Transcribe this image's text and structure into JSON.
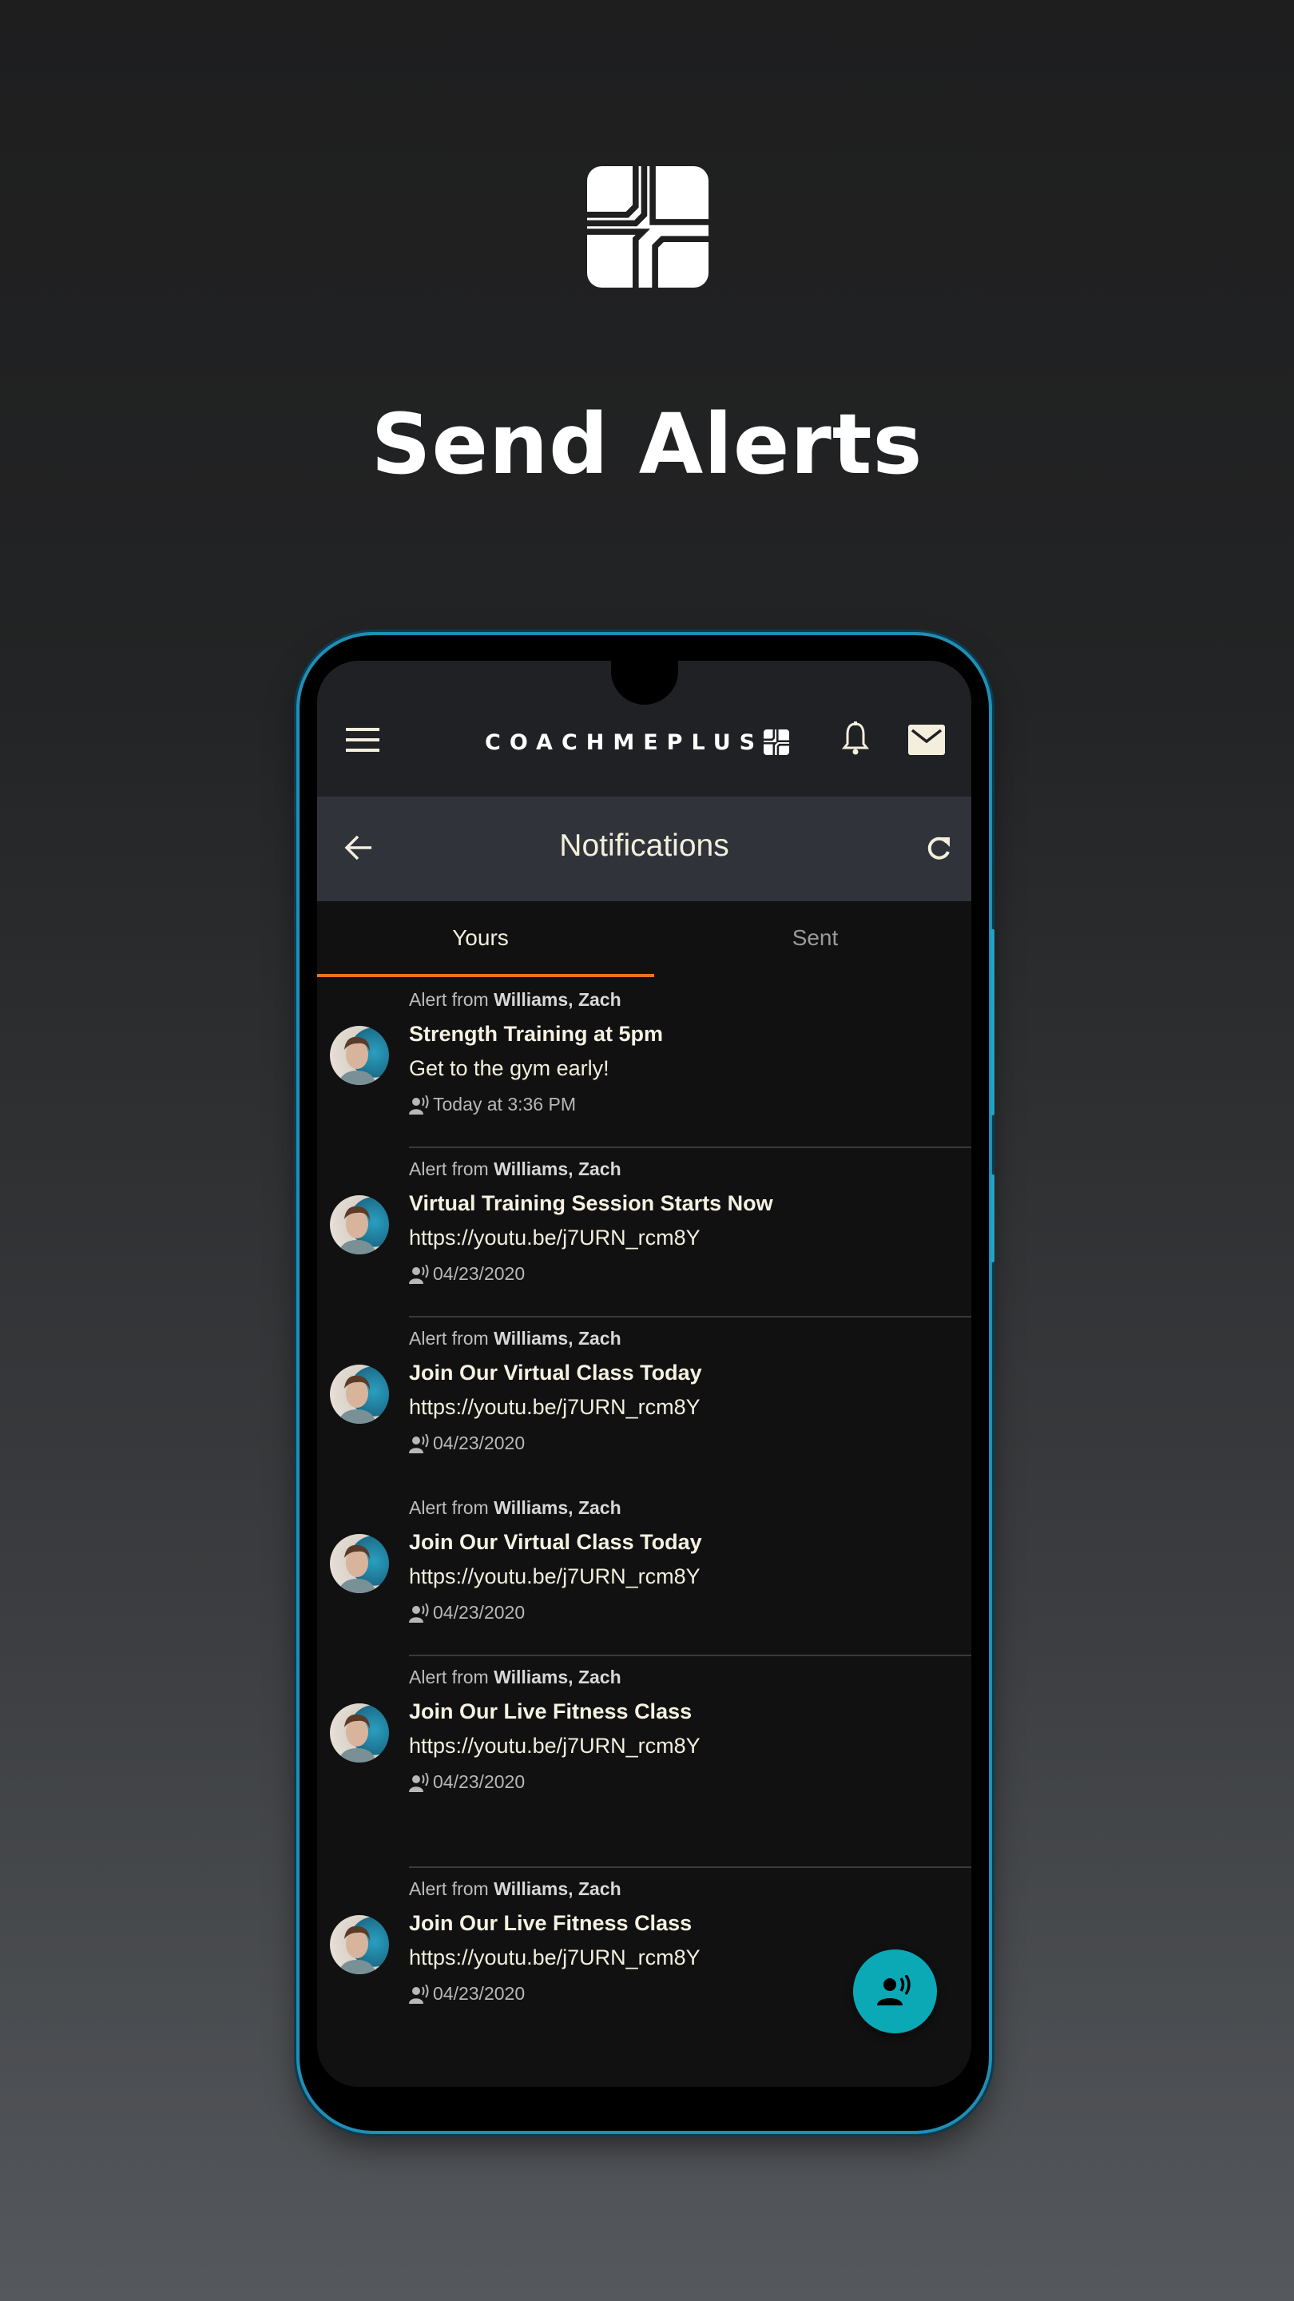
{
  "headline": "Send Alerts",
  "app": {
    "logo_text": "COACHMEPLUS",
    "nav_title": "Notifications",
    "tabs": [
      {
        "label": "Yours",
        "active": true
      },
      {
        "label": "Sent",
        "active": false
      }
    ]
  },
  "colors": {
    "accent_tab": "#e8741c",
    "fab": "#0ba8b6",
    "phone_frame": "#1f8fb5",
    "text": "#f3efdc"
  },
  "items": [
    {
      "prefix": "Alert from",
      "sender": "Williams, Zach",
      "title": "Strength Training at 5pm",
      "body": "Get to the gym early!",
      "date": "Today at 3:36 PM"
    },
    {
      "prefix": "Alert from",
      "sender": "Williams, Zach",
      "title": "Virtual Training Session Starts Now",
      "body": "https://youtu.be/j7URN_rcm8Y",
      "date": "04/23/2020"
    },
    {
      "prefix": "Alert from",
      "sender": "Williams, Zach",
      "title": "Join Our Virtual Class Today",
      "body": "https://youtu.be/j7URN_rcm8Y",
      "date": "04/23/2020"
    },
    {
      "prefix": "Alert from",
      "sender": "Williams, Zach",
      "title": "Join Our Virtual Class Today",
      "body": "https://youtu.be/j7URN_rcm8Y",
      "date": "04/23/2020"
    },
    {
      "prefix": "Alert from",
      "sender": "Williams, Zach",
      "title": "Join Our Live Fitness Class",
      "body": "https://youtu.be/j7URN_rcm8Y",
      "date": "04/23/2020"
    },
    {
      "prefix": "Alert from",
      "sender": "Williams, Zach",
      "title": "Join Our Live Fitness Class",
      "body": "https://youtu.be/j7URN_rcm8Y",
      "date": "04/23/2020"
    }
  ]
}
